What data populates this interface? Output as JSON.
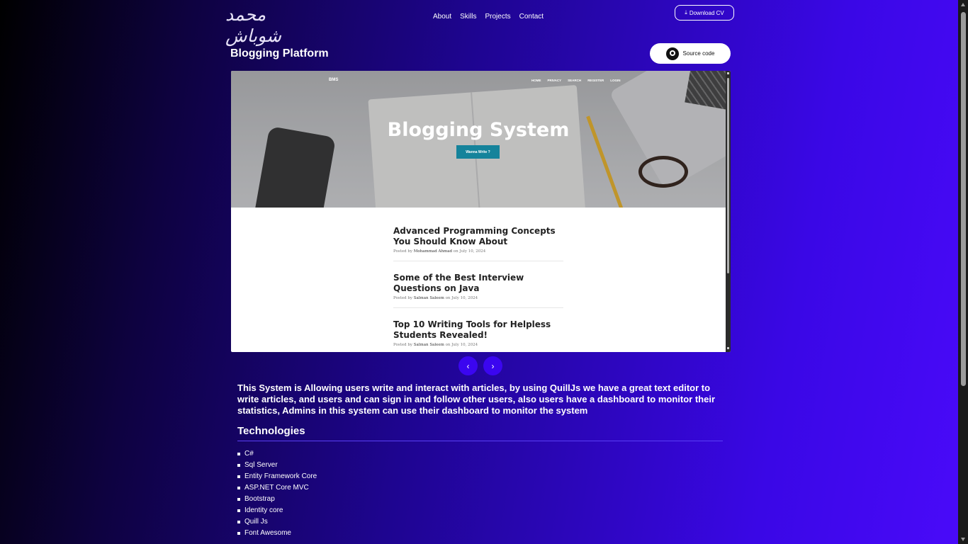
{
  "header": {
    "logo_text": "محمد شوباش",
    "nav": [
      "About",
      "Skills",
      "Projects",
      "Contact"
    ],
    "cv_label": "Download CV"
  },
  "project": {
    "title": "Blogging Platform",
    "source_label": "Source code"
  },
  "preview": {
    "brand": "BMS",
    "nav": [
      "HOME",
      "PRIVACY",
      "SEARCH",
      "REGISTER",
      "LOGIN"
    ],
    "hero_title": "Blogging System",
    "hero_button": "Wanna Write ?",
    "articles": [
      {
        "title": "Advanced Programming Concepts You Should Know About",
        "posted": "Posted by",
        "author": "Mohammad Ahmad",
        "date": "on July 10, 2024"
      },
      {
        "title": "Some of the Best Interview Questions on Java",
        "posted": "Posted by",
        "author": "Salman Saleem",
        "date": "on July 10, 2024"
      },
      {
        "title": "Top 10 Writing Tools for Helpless Students Revealed!",
        "posted": "Posted by",
        "author": "Salman Saleem",
        "date": "on July 10, 2024"
      }
    ]
  },
  "carousel": {
    "prev": "‹",
    "next": "›"
  },
  "description": "This System is Allowing users write and interact with articles, by using QuillJs we have a great text editor to write articles, and users and can sign in and follow other users, also users have a dashboard to monitor their statistics, Admins in this system can use their dashboard to monitor the system",
  "technologies": {
    "title": "Technologies",
    "items": [
      "C#",
      "Sql Server",
      "Entity Framework Core",
      "ASP.NET Core MVC",
      "Bootstrap",
      "Identity core",
      "Quill Js",
      "Font Awesome"
    ]
  },
  "colors": {
    "accent": "#3b06f0",
    "hero_button": "#15839b"
  }
}
